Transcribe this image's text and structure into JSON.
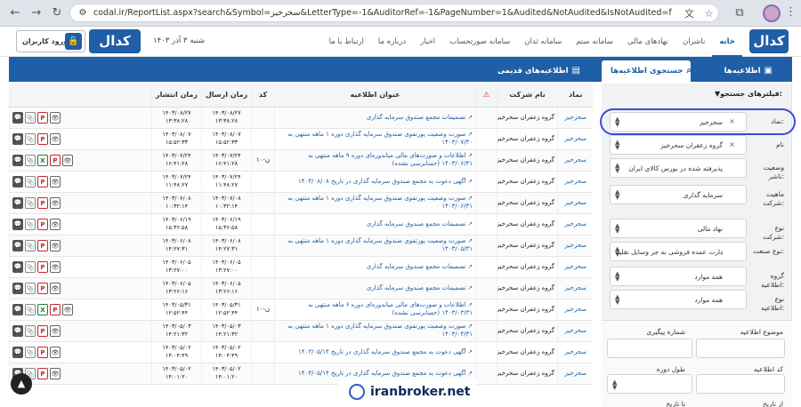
{
  "browser": {
    "url": "codal.ir/ReportList.aspx?search&Symbol=سحرخیز&LetterType=-1&AuditorRef=-1&PageNumber=1&Audited&NotAudited&IsNotAudited=false&Childs..."
  },
  "header": {
    "login_label": "ورود کاربران",
    "date": "شنبه ۳ آذر ۱۴۰۳",
    "logo_text": "کدال",
    "nav": [
      "خانه",
      "ناشران",
      "نهادهای مالی",
      "سامانه ستم",
      "سامانه ثدان",
      "سامانه صورتحساب",
      "اخبار",
      "درباره ما",
      "ارتباط با ما"
    ]
  },
  "tabs": {
    "announcements": "اطلاعیه‌ها",
    "search": "جستجوی اطلاعیه‌ها",
    "old": "اطلاعیه‌های قدیمی"
  },
  "filters": {
    "title": "فیلترهای جستجو:",
    "rows": [
      {
        "label": "نماد:",
        "value": "سحرخیز",
        "clear": true
      },
      {
        "label": "نام",
        "value": "گروه زعفران سحرخیز",
        "clear": true
      },
      {
        "label": "وضعیت ناشر:",
        "value": "پذیرفته شده در بورس کالای ایران",
        "clear": false
      },
      {
        "label": "ماهیت شرکت:",
        "value": "سرمایه گذاری",
        "clear": false
      },
      {
        "label": "نوع شرکت:",
        "value": "نهاد مالی",
        "clear": false
      },
      {
        "label": "نوع صنعت:",
        "value": "تجارت عمده فروشی به جز وسایل نقلیه...",
        "clear": false
      },
      {
        "label": "گروه اطلاعیه:",
        "value": "همه موارد",
        "clear": false
      },
      {
        "label": "نوع اطلاعیه:",
        "value": "همه موارد",
        "clear": false
      }
    ],
    "topic_label": "موضوع اطلاعیه",
    "tracking_label": "شماره پیگیری",
    "code_label": "کد اطلاعیه",
    "period_label": "طول دوره",
    "from_label": "از تاریخ",
    "to_label": "تا تاریخ"
  },
  "table": {
    "headers": [
      "نماد",
      "نام شرکت",
      "⚠",
      "عنوان اطلاعیه",
      "کد",
      "زمان ارسال",
      "زمان انتشار",
      ""
    ],
    "rows": [
      {
        "sym": "سحرخیز",
        "comp": "گروه زعفران سحرخیز",
        "title": "تصمیمات مجمع صندوق سرمایه گذاری",
        "code": "",
        "sent": "۱۴۰۳/۰۸/۲۷ ۱۳:۳۸:۲۸",
        "pub": "۱۴۰۳/۰۸/۲۷ ۱۳:۳۸:۲۸",
        "acts": [
          "view",
          "pdf",
          "att",
          "msg"
        ]
      },
      {
        "sym": "سحرخیز",
        "comp": "گروه زعفران سحرخیز",
        "title": "صورت وضعیت پورتفوی صندوق سرمایه گذاری دوره ۱ ماهه منتهی به ۱۴۰۳/۰۷/۳۰",
        "code": "",
        "sent": "۱۴۰۳/۰۸/۰۷ ۱۵:۵۲:۳۳",
        "pub": "۱۴۰۳/۰۸/۰۷ ۱۵:۵۲:۳۳",
        "acts": [
          "view",
          "pdf",
          "att",
          "msg"
        ]
      },
      {
        "sym": "سحرخیز",
        "comp": "گروه زعفران سحرخیز",
        "title": "اطلاعات و صورت‌های مالی میاندوره‌ای دوره ۹ ماهه منتهی به ۱۴۰۳/۰۶/۳۱ (حسابرسی نشده)",
        "code": "ن-۱۰",
        "sent": "۱۴۰۳/۰۷/۲۴ ۱۶:۴۱:۲۸",
        "pub": "۱۴۰۳/۰۷/۲۴ ۱۶:۴۱:۲۸",
        "acts": [
          "view",
          "pdf",
          "xls",
          "att",
          "msg"
        ]
      },
      {
        "sym": "سحرخیز",
        "comp": "گروه زعفران سحرخیز",
        "title": "آگهی دعوت به مجمع صندوق سرمایه گذاری در تاریخ ۱۴۰۳/۰۸/۰۸",
        "code": "",
        "sent": "۱۴۰۳/۰۷/۲۴ ۱۱:۴۸:۲۷",
        "pub": "۱۴۰۳/۰۷/۲۴ ۱۱:۴۸:۲۷",
        "acts": [
          "view",
          "pdf",
          "att",
          "msg"
        ]
      },
      {
        "sym": "سحرخیز",
        "comp": "گروه زعفران سحرخیز",
        "title": "صورت وضعیت پورتفوی صندوق سرمایه گذاری دوره ۱ ماهه منتهی به ۱۴۰۳/۰۶/۳۱",
        "code": "",
        "sent": "۱۴۰۳/۰۷/۰۸ ۱۰:۳۲:۱۴",
        "pub": "۱۴۰۳/۰۷/۰۸ ۱۰:۳۲:۱۴",
        "acts": [
          "view",
          "pdf",
          "att",
          "msg"
        ]
      },
      {
        "sym": "سحرخیز",
        "comp": "گروه زعفران سحرخیز",
        "title": "تصمیمات مجمع صندوق سرمایه گذاری",
        "code": "",
        "sent": "۱۴۰۳/۰۶/۱۹ ۱۵:۳۶:۵۸",
        "pub": "۱۴۰۳/۰۶/۱۹ ۱۵:۳۶:۵۸",
        "acts": [
          "view",
          "pdf",
          "att",
          "msg"
        ]
      },
      {
        "sym": "سحرخیز",
        "comp": "گروه زعفران سحرخیز",
        "title": "صورت وضعیت پورتفوی صندوق سرمایه گذاری دوره ۱ ماهه منتهی به ۱۴۰۳/۰۵/۳۱",
        "code": "",
        "sent": "۱۴۰۳/۰۶/۰۸ ۱۴:۲۷:۳۱",
        "pub": "۱۴۰۳/۰۶/۰۸ ۱۴:۲۷:۳۱",
        "acts": [
          "view",
          "pdf",
          "att",
          "msg"
        ]
      },
      {
        "sym": "سحرخیز",
        "comp": "گروه زعفران سحرخیز",
        "title": "تصمیمات مجمع صندوق سرمایه گذاری",
        "code": "",
        "sent": "۱۴۰۳/۰۶/۰۵ ۱۳:۲۷:۰۰",
        "pub": "۱۴۰۳/۰۶/۰۵ ۱۳:۲۷:۰۰",
        "acts": [
          "view",
          "pdf",
          "att",
          "msg"
        ]
      },
      {
        "sym": "سحرخیز",
        "comp": "گروه زعفران سحرخیز",
        "title": "تصمیمات مجمع صندوق سرمایه گذاری",
        "code": "",
        "sent": "۱۴۰۳/۰۶/۰۵ ۱۳:۲۶:۱۶",
        "pub": "۱۴۰۳/۰۶/۰۵ ۱۳:۲۶:۱۶",
        "acts": [
          "view",
          "pdf",
          "att",
          "msg"
        ]
      },
      {
        "sym": "سحرخیز",
        "comp": "گروه زعفران سحرخیز",
        "title": "اطلاعات و صورت‌های مالی میاندوره‌ای دوره ۶ ماهه منتهی به ۱۴۰۳/۰۳/۳۱ (حسابرسی نشده)",
        "code": "ن-۱۰",
        "sent": "۱۴۰۳/۰۵/۳۱ ۱۲:۵۲:۴۴",
        "pub": "۱۴۰۳/۰۵/۳۱ ۱۲:۵۲:۴۴",
        "acts": [
          "view",
          "pdf",
          "xls",
          "att",
          "msg"
        ]
      },
      {
        "sym": "سحرخیز",
        "comp": "گروه زعفران سحرخیز",
        "title": "صورت وضعیت پورتفوی صندوق سرمایه گذاری دوره ۱ ماهه منتهی به ۱۴۰۳/۰۴/۳۱",
        "code": "",
        "sent": "۱۴۰۳/۰۵/۰۳ ۱۴:۲۱:۳۲",
        "pub": "۱۴۰۳/۰۵/۰۳ ۱۴:۲۱:۳۲",
        "acts": [
          "view",
          "pdf",
          "att",
          "msg"
        ]
      },
      {
        "sym": "سحرخیز",
        "comp": "گروه زعفران سحرخیز",
        "title": "آگهی دعوت به مجمع صندوق سرمایه گذاری در تاریخ ۱۴۰۳/۰۵/۱۴",
        "code": "",
        "sent": "۱۴۰۳/۰۵/۰۲ ۱۴:۰۴:۴۹",
        "pub": "۱۴۰۳/۰۵/۰۲ ۱۴:۰۴:۴۹",
        "acts": [
          "view",
          "pdf",
          "att",
          "msg"
        ]
      },
      {
        "sym": "سحرخیز",
        "comp": "گروه زعفران سحرخیز",
        "title": "آگهی دعوت به مجمع صندوق سرمایه گذاری در تاریخ ۱۴۰۳/۰۵/۱۴",
        "code": "",
        "sent": "۱۴۰۳/۰۵/۰۲ ۱۴:۰۱:۲۰",
        "pub": "۱۴۰۳/۰۵/۰۲ ۱۴:۰۱:۲۰",
        "acts": [
          "view",
          "pdf",
          "att",
          "msg"
        ]
      }
    ]
  },
  "watermark": "iranbroker.net"
}
